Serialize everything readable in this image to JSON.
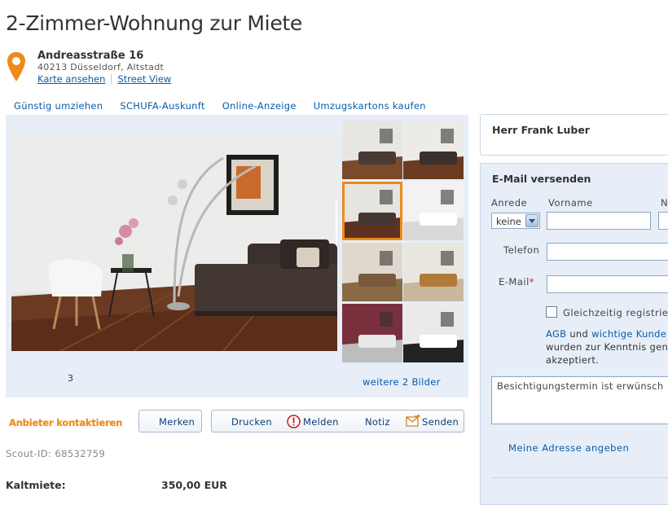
{
  "page_title": "2-Zimmer-Wohnung zur Miete",
  "address": {
    "street": "Andreasstraße 16",
    "city": "40213 Düsseldorf, Altstadt",
    "map_link": "Karte ansehen",
    "streetview_link": "Street View"
  },
  "tabs": [
    "Günstig umziehen",
    "SCHUFA-Auskunft",
    "Online-Anzeige",
    "Umzugskartons kaufen"
  ],
  "gallery": {
    "counter": "3",
    "more_link": "weitere 2 Bilder",
    "thumbnail_count": 8,
    "selected_thumbnail": 3
  },
  "actions": {
    "contact_landlord": "Anbieter kontaktieren",
    "bookmark": "Merken",
    "print": "Drucken",
    "report": "Melden",
    "note": "Notiz",
    "send": "Senden"
  },
  "scout_id": "Scout-ID: 68532759",
  "details": {
    "kaltmiete_label": "Kaltmiete:",
    "kaltmiete_value": "350,00 EUR"
  },
  "contact": {
    "name": "Herr Frank Luber"
  },
  "email_form": {
    "heading": "E-Mail versenden",
    "anrede_label": "Anrede",
    "anrede_value": "keine",
    "vorname_label": "Vorname",
    "nachname_label": "N",
    "telefon_label": "Telefon",
    "email_label": "E-Mail",
    "required_mark": "*",
    "checkbox_label": "Gleichzeitig registrie",
    "agb_link": "AGB",
    "agb_and": "und",
    "agb_link2": "wichtige Kunde",
    "agb_line2": "wurden zur Kenntnis gen",
    "agb_line3": "akzeptiert.",
    "message_value": "Besichtigungstermin ist erwünsch",
    "my_address_link": "Meine Adresse angeben"
  },
  "colors": {
    "accent_orange": "#f08a1a",
    "link_blue": "#0a5ca8",
    "panel_bg": "#e7eef8"
  }
}
